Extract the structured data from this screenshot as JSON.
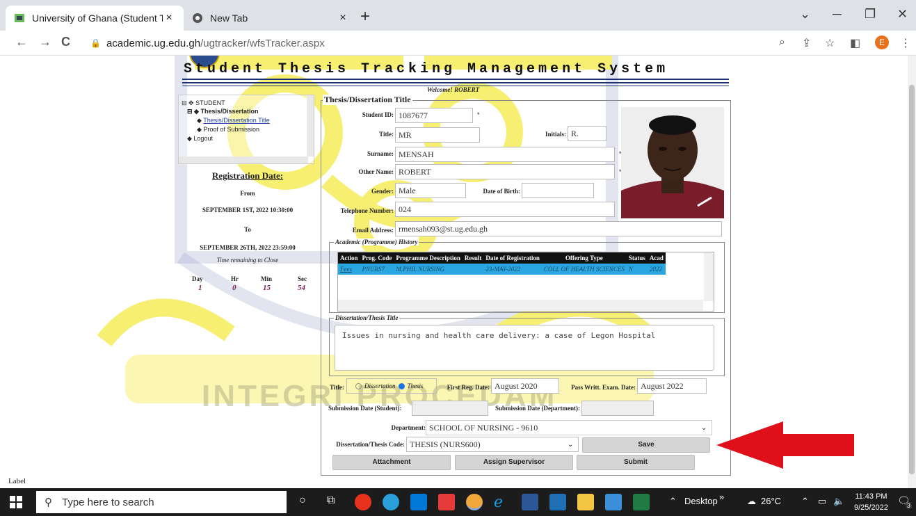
{
  "browser": {
    "tabs": [
      {
        "title": "University of Ghana (Student The",
        "close": "×"
      },
      {
        "title": "New Tab",
        "close": "×"
      }
    ],
    "new_tab": "+",
    "window_controls": {
      "minimize": "─",
      "restore": "❐",
      "close": "✕",
      "dropdown": "⌄"
    },
    "nav": {
      "back": "←",
      "forward": "→",
      "reload": "C"
    },
    "url_host": "academic.ug.edu.gh",
    "url_path": "/ugtracker/wfsTracker.aspx",
    "profile_initial": "E"
  },
  "page": {
    "system_title": "Student Thesis Tracking Management System",
    "welcome": "Welcome! ROBERT",
    "tree": {
      "root": "STUDENT",
      "thesis": "Thesis/Dissertation",
      "thesis_title_link": "Thesis/Dissertation Title",
      "proof": "Proof of Submission",
      "logout": "Logout"
    },
    "registration": {
      "heading": "Registration Date:",
      "from_label": "From",
      "from_date": "SEPTEMBER 1ST, 2022 10:30:00",
      "to_label": "To",
      "to_date": "SEPTEMBER 26TH, 2022 23:59:00",
      "remaining_label": "Time remaining to Close",
      "timer_headers": [
        "Day",
        "Hr",
        "Min",
        "Sec"
      ],
      "timer_values": [
        "1",
        "0",
        "15",
        "54"
      ]
    },
    "form": {
      "legend": "Thesis/Dissertation Title",
      "student_id_label": "Student ID:",
      "student_id": "1087677",
      "title_label": "Title:",
      "title": "MR",
      "initials_label": "Initials:",
      "initials": "R.",
      "surname_label": "Surname:",
      "surname": "MENSAH",
      "other_name_label": "Other Name:",
      "other_name": "ROBERT",
      "gender_label": "Gender:",
      "gender": "Male",
      "dob_label": "Date of Birth:",
      "dob": "",
      "telephone_label": "Telephone Number:",
      "telephone": "024",
      "email_label": "Email Address:",
      "email": "rmensah093@st.ug.edu.gh",
      "required_mark": "*",
      "academic_legend": "Academic (Programme) History",
      "grid_headers": [
        "Action",
        "Prog. Code",
        "Programme Description",
        "Result",
        "Date of Registration",
        "Offering Type",
        "Status",
        "Acad"
      ],
      "grid_rows": [
        [
          "Fees",
          "PNURS7",
          "M.PHIL NURSING",
          "",
          "23-MAY-2022",
          "COLL OF HEALTH SCIENCES",
          "N",
          "2022"
        ]
      ],
      "thesis_legend": "Dissertation/Thesis Title",
      "thesis_title": "Issues in nursing and health care delivery: a case of Legon Hospital",
      "title_type_label": "Title:",
      "opt_dissertation": "Dissertation",
      "opt_thesis": "Thesis",
      "first_reg_label": "First Reg. Date:",
      "first_reg": "August 2020",
      "pass_exam_label": "Pass Writt. Exam. Date:",
      "pass_exam": "August 2022",
      "sub_student_label": "Submission Date (Student):",
      "sub_dept_label": "Submission Date (Department):",
      "department_label": "Department:",
      "department": "SCHOOL OF NURSING - 9610",
      "code_label": "Dissertation/Thesis Code:",
      "code": "THESIS (NURS600)",
      "save": "Save",
      "attachment": "Attachment",
      "assign_supervisor": "Assign Supervisor",
      "submit": "Submit"
    },
    "footer_label": "Label",
    "watermark_text": "INTEGRI PROCEDAM"
  },
  "taskbar": {
    "search_placeholder": "Type here to search",
    "desktop": "Desktop",
    "chevron": "»",
    "weather": "26°C",
    "time": "11:43 PM",
    "date": "9/25/2022",
    "notifications": "3"
  },
  "colors": {
    "accent_blue": "#1a2f78",
    "grid_row": "#2aa6e0",
    "arrow_red": "#e0101a",
    "watermark_gold": "#f2e200"
  }
}
